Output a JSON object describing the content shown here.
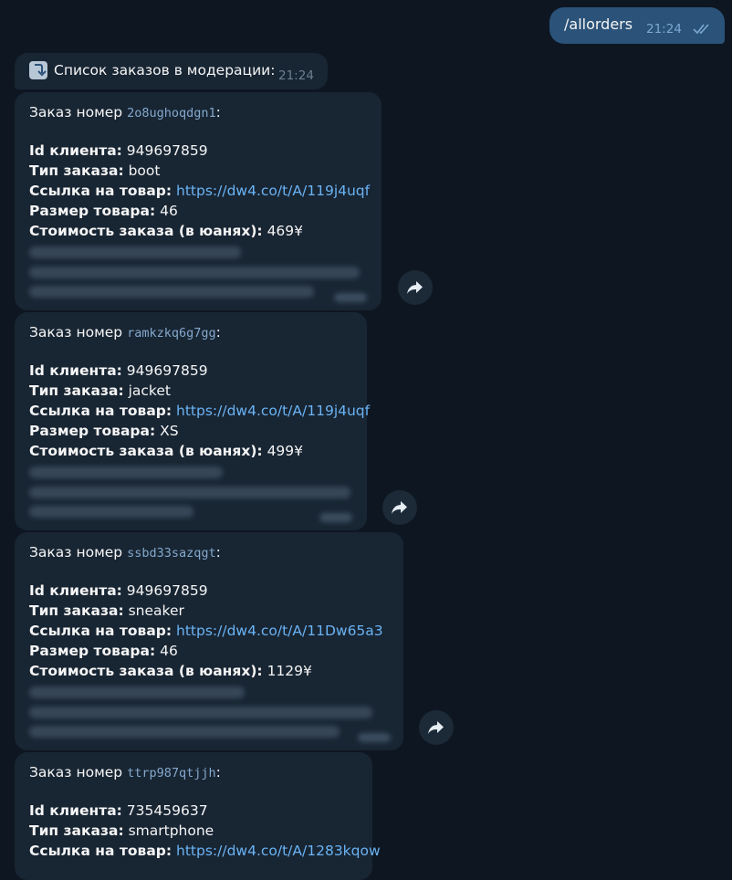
{
  "outgoing": {
    "text": "/allorders",
    "time": "21:24"
  },
  "header": {
    "text": "Список заказов в модерации:",
    "time": "21:24"
  },
  "labels": {
    "order_prefix": "Заказ номер",
    "client_id": "Id клиента:",
    "type": "Тип заказа:",
    "link": "Ссылка на товар:",
    "size": "Размер товара:",
    "price": "Стоимость заказа (в юанях):"
  },
  "orders": [
    {
      "code": "2o8ughoqdgn1",
      "client_id": "949697859",
      "type": "boot",
      "link": "https://dw4.co/t/A/119j4uqf",
      "size": "46",
      "price": "469¥"
    },
    {
      "code": "ramkzkq6g7gg",
      "client_id": "949697859",
      "type": "jacket",
      "link": "https://dw4.co/t/A/119j4uqf",
      "size": "XS",
      "price": "499¥"
    },
    {
      "code": "ssbd33sazqgt",
      "client_id": "949697859",
      "type": "sneaker",
      "link": "https://dw4.co/t/A/11Dw65a3",
      "size": "46",
      "price": "1129¥"
    },
    {
      "code": "ttrp987qtjjh",
      "client_id": "735459637",
      "type": "smartphone",
      "link": "https://dw4.co/t/A/1283kqow"
    }
  ],
  "colors": {
    "background": "#0e1621",
    "incoming": "#182533",
    "outgoing": "#2b5278",
    "link": "#6ab3f3"
  }
}
